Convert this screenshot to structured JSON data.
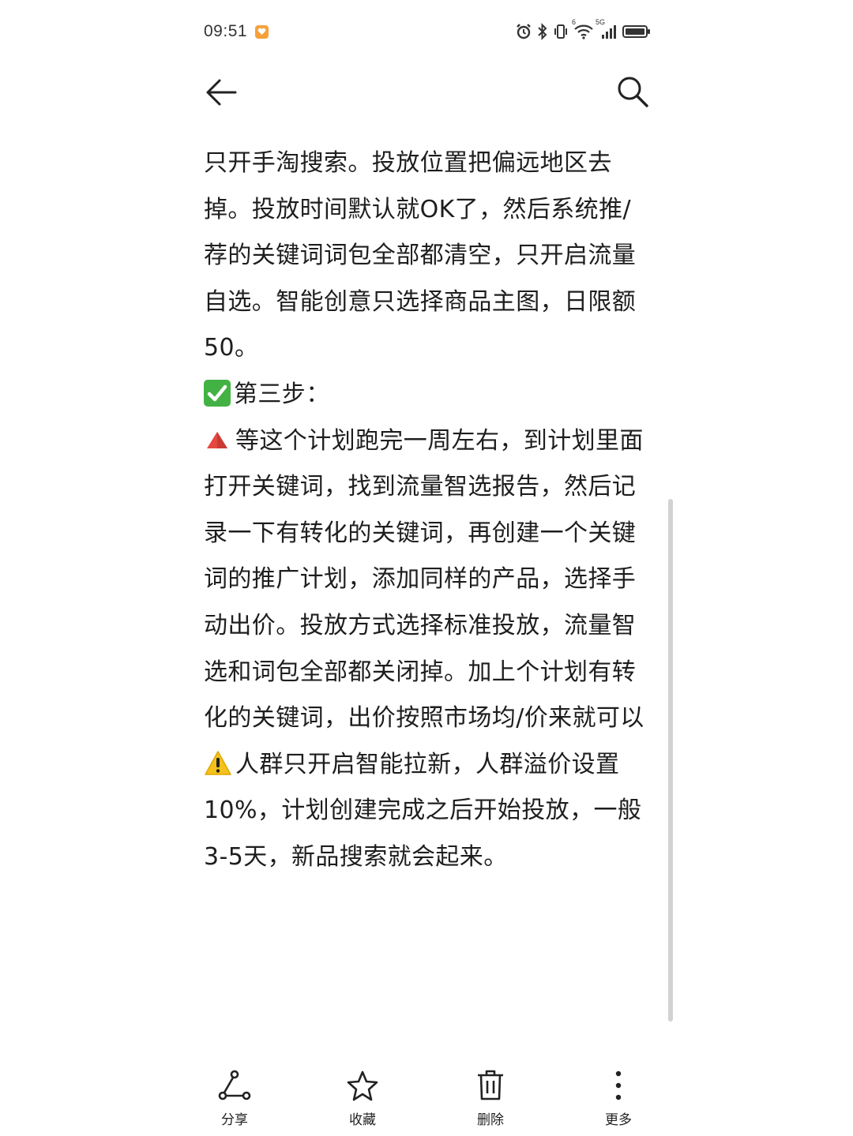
{
  "status_bar": {
    "time": "09:51",
    "network_label": "5G",
    "wifi_label": "6"
  },
  "nav": {
    "back_icon": "back-arrow-icon",
    "search_icon": "search-icon"
  },
  "article": {
    "para1": "只开手淘搜索。投放位置把偏远地区去掉。投放时间默认就OK了，然后系统推/荐的关键词词包全部都清空，只开启流量自选。智能创意只选择商品主图，日限额50。",
    "step_heading": "第三步：",
    "para2": "等这个计划跑完一周左右，到计划里面打开关键词，找到流量智选报告，然后记录一下有转化的关键词，再创建一个关键词的推广计划，添加同样的产品，选择手动出价。投放方式选择标准投放，流量智选和词包全部都关闭掉。加上个计划有转化的关键词，出价按照市场均/价来就可以",
    "para3": "人群只开启智能拉新，人群溢价设置10%，计划创建完成之后开始投放，一般3-5天，新品搜索就会起来。"
  },
  "bottom_bar": {
    "share_label": "分享",
    "favorite_label": "收藏",
    "delete_label": "删除",
    "more_label": "更多"
  },
  "colors": {
    "check_green": "#43b244",
    "triangle_red": "#e5483f",
    "warning_yellow": "#f5c21b",
    "notif_orange": "#f6a13a"
  }
}
